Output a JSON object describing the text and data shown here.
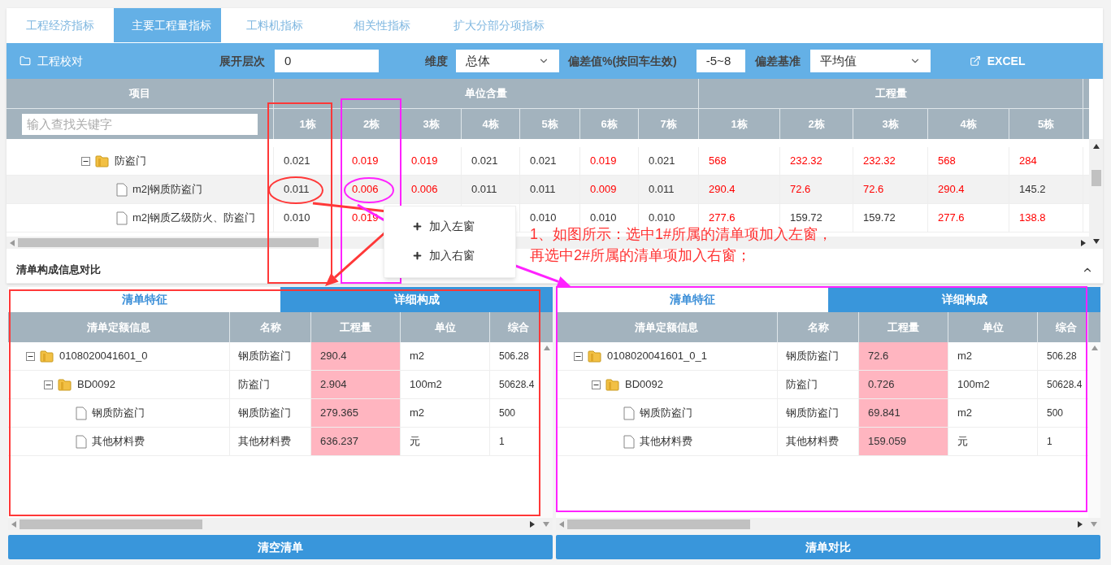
{
  "tabs": [
    {
      "label": "工程经济指标",
      "selected": false
    },
    {
      "label": "主要工程量指标",
      "selected": true
    },
    {
      "label": "工料机指标",
      "selected": false
    },
    {
      "label": "相关性指标",
      "selected": false
    },
    {
      "label": "扩大分部分项指标",
      "selected": false
    }
  ],
  "toolbar": {
    "title": "工程校对",
    "expand_level": {
      "label": "展开层次",
      "value": "0"
    },
    "dimension": {
      "label": "维度",
      "value": "总体"
    },
    "deviation": {
      "label": "偏差值%(按回车生效)",
      "value": "-5~8"
    },
    "baseline": {
      "label": "偏差基准",
      "value": "平均值"
    },
    "export": "EXCEL"
  },
  "grid": {
    "item_header": "项目",
    "search_placeholder": "输入查找关键字",
    "groups": [
      {
        "title": "单位含量",
        "columns": [
          "1栋",
          "2栋",
          "3栋",
          "4栋",
          "5栋",
          "6栋",
          "7栋"
        ]
      },
      {
        "title": "工程量",
        "columns": [
          "1栋",
          "2栋",
          "3栋",
          "4栋",
          "5栋"
        ]
      }
    ],
    "rows": [
      {
        "label": "防盗门",
        "kind": "folder",
        "expanded": true,
        "selected": false,
        "cells": [
          {
            "value": "0.021",
            "deviation": false
          },
          {
            "value": "0.019",
            "deviation": true
          },
          {
            "value": "0.019",
            "deviation": true
          },
          {
            "value": "0.021",
            "deviation": false
          },
          {
            "value": "0.021",
            "deviation": false
          },
          {
            "value": "0.019",
            "deviation": true
          },
          {
            "value": "0.021",
            "deviation": false
          },
          {
            "value": "568",
            "deviation": true
          },
          {
            "value": "232.32",
            "deviation": true
          },
          {
            "value": "232.32",
            "deviation": true
          },
          {
            "value": "568",
            "deviation": true
          },
          {
            "value": "284",
            "deviation": true
          }
        ],
        "children": [
          {
            "label": "m2|钢质防盗门",
            "kind": "file",
            "selected": true,
            "cells": [
              {
                "value": "0.011",
                "deviation": false
              },
              {
                "value": "0.006",
                "deviation": true
              },
              {
                "value": "0.006",
                "deviation": true
              },
              {
                "value": "0.011",
                "deviation": false
              },
              {
                "value": "0.011",
                "deviation": false
              },
              {
                "value": "0.009",
                "deviation": true
              },
              {
                "value": "0.011",
                "deviation": false
              },
              {
                "value": "290.4",
                "deviation": true
              },
              {
                "value": "72.6",
                "deviation": true
              },
              {
                "value": "72.6",
                "deviation": true
              },
              {
                "value": "290.4",
                "deviation": true
              },
              {
                "value": "145.2",
                "deviation": false
              }
            ]
          },
          {
            "label": "m2|钢质乙级防火、防盗门",
            "kind": "file",
            "selected": false,
            "cells": [
              {
                "value": "0.010",
                "deviation": false
              },
              {
                "value": "0.019",
                "deviation": true
              },
              null,
              null,
              {
                "value": "0.010",
                "deviation": false
              },
              {
                "value": "0.010",
                "deviation": false
              },
              {
                "value": "0.010",
                "deviation": false
              },
              {
                "value": "277.6",
                "deviation": true
              },
              {
                "value": "159.72",
                "deviation": false
              },
              {
                "value": "159.72",
                "deviation": false
              },
              {
                "value": "277.6",
                "deviation": true
              },
              {
                "value": "138.8",
                "deviation": true
              }
            ]
          }
        ]
      }
    ]
  },
  "context_menu": [
    {
      "label": "加入左窗"
    },
    {
      "label": "加入右窗"
    }
  ],
  "annotation": {
    "lines": [
      "1、如图所示：选中1#所属的清单项加入左窗，",
      "再选中2#所属的清单项加入右窗；"
    ]
  },
  "compare": {
    "title": "清单构成信息对比",
    "panels": [
      {
        "tabs": [
          {
            "label": "清单特征",
            "selected": true
          },
          {
            "label": "详细构成",
            "selected": false
          }
        ],
        "columns": [
          "清单定额信息",
          "名称",
          "工程量",
          "单位",
          "综合"
        ],
        "rows": [
          {
            "info": "0108020041601_0",
            "name": "钢质防盗门",
            "quantity": "290.4",
            "unit": "m2",
            "price": "506.28",
            "kind": "folder",
            "expanded": true,
            "children": [
              {
                "info": "BD0092",
                "name": "防盗门",
                "quantity": "2.904",
                "unit": "100m2",
                "price": "50628.4",
                "kind": "folder",
                "expanded": true,
                "children": [
                  {
                    "info": "钢质防盗门",
                    "name": "钢质防盗门",
                    "quantity": "279.365",
                    "unit": "m2",
                    "price": "500",
                    "kind": "file"
                  },
                  {
                    "info": "其他材料费",
                    "name": "其他材料费",
                    "quantity": "636.237",
                    "unit": "元",
                    "price": "1",
                    "kind": "file"
                  }
                ]
              }
            ]
          }
        ],
        "button": "清空清单"
      },
      {
        "tabs": [
          {
            "label": "清单特征",
            "selected": true
          },
          {
            "label": "详细构成",
            "selected": false
          }
        ],
        "columns": [
          "清单定额信息",
          "名称",
          "工程量",
          "单位",
          "综合"
        ],
        "rows": [
          {
            "info": "0108020041601_0_1",
            "name": "钢质防盗门",
            "quantity": "72.6",
            "unit": "m2",
            "price": "506.28",
            "kind": "folder",
            "expanded": true,
            "children": [
              {
                "info": "BD0092",
                "name": "防盗门",
                "quantity": "0.726",
                "unit": "100m2",
                "price": "50628.4",
                "kind": "folder",
                "expanded": true,
                "children": [
                  {
                    "info": "钢质防盗门",
                    "name": "钢质防盗门",
                    "quantity": "69.841",
                    "unit": "m2",
                    "price": "500",
                    "kind": "file"
                  },
                  {
                    "info": "其他材料费",
                    "name": "其他材料费",
                    "quantity": "159.059",
                    "unit": "元",
                    "price": "1",
                    "kind": "file"
                  }
                ]
              }
            ]
          }
        ],
        "button": "清单对比"
      }
    ]
  }
}
